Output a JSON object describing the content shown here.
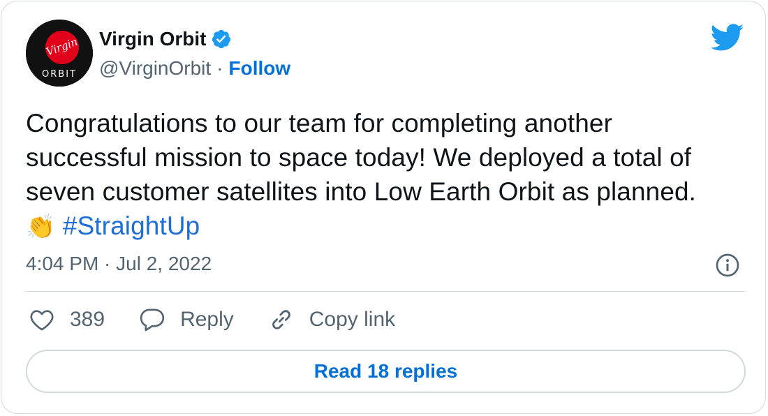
{
  "author": {
    "display_name": "Virgin Orbit",
    "handle": "@VirginOrbit",
    "separator": "·",
    "follow_label": "Follow",
    "avatar_logo_text": "Virgin",
    "avatar_sub_text": "ORBIT",
    "verified": true
  },
  "tweet": {
    "text_lines": [
      "Congratulations to our team for completing another",
      "successful mission to space today! We deployed a total of",
      "seven customer satellites into Low Earth Orbit as planned."
    ],
    "emoji": "👏",
    "hashtag": "#StraightUp",
    "timestamp": "4:04 PM · Jul 2, 2022"
  },
  "actions": {
    "like_count": "389",
    "reply_label": "Reply",
    "copy_link_label": "Copy link"
  },
  "footer": {
    "read_replies_label": "Read 18 replies"
  },
  "colors": {
    "link": "#006fd6",
    "text": "#0f1419",
    "muted": "#536471",
    "border": "#cfd9de",
    "brand_red": "#e1001a",
    "twitter_blue": "#1d9bf0"
  },
  "icons": {
    "brand": "twitter-bird-icon",
    "verified": "verified-badge-icon",
    "info": "info-icon",
    "like": "heart-icon",
    "reply": "speech-bubble-icon",
    "copy_link": "link-icon"
  }
}
